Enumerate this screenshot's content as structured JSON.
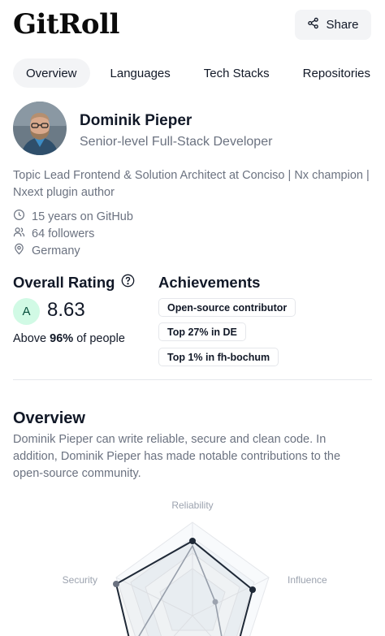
{
  "header": {
    "logo": "GitRoll",
    "share_label": "Share"
  },
  "tabs": [
    {
      "label": "Overview",
      "active": true
    },
    {
      "label": "Languages",
      "active": false
    },
    {
      "label": "Tech Stacks",
      "active": false
    },
    {
      "label": "Repositories",
      "active": false
    }
  ],
  "profile": {
    "name": "Dominik Pieper",
    "role": "Senior-level Full-Stack Developer",
    "bio": "Topic Lead Frontend & Solution Architect at Conciso | Nx champion | Nxext plugin author",
    "meta": {
      "github_years": "15 years on GitHub",
      "followers": "64 followers",
      "location": "Germany"
    }
  },
  "rating": {
    "title": "Overall Rating",
    "grade": "A",
    "score": "8.63",
    "percentile_prefix": "Above ",
    "percentile_value": "96%",
    "percentile_suffix": " of people"
  },
  "achievements": {
    "title": "Achievements",
    "badges": [
      "Open-source contributor",
      "Top 27% in DE",
      "Top 1% in fh-bochum"
    ]
  },
  "overview": {
    "title": "Overview",
    "text": "Dominik Pieper can write reliable, secure and clean code. In addition, Dominik Pieper has made notable contributions to the open-source community."
  },
  "radar": {
    "axes": [
      "Reliability",
      "Influence",
      "Security"
    ],
    "colors": {
      "user": "#1f2937",
      "peer": "#9ca3af",
      "grid": "#e5e7eb",
      "fill": "#f1f5f9"
    }
  }
}
